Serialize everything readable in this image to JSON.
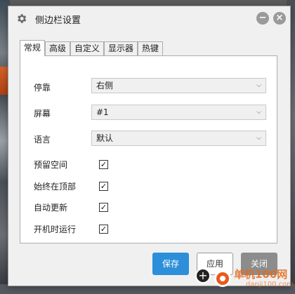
{
  "window": {
    "title": "侧边栏设置",
    "minimize_symbol": "−",
    "close_symbol": "×"
  },
  "tabs": [
    {
      "label": "常规",
      "active": true
    },
    {
      "label": "高级",
      "active": false
    },
    {
      "label": "自定义",
      "active": false
    },
    {
      "label": "显示器",
      "active": false
    },
    {
      "label": "热键",
      "active": false
    }
  ],
  "settings": {
    "dock": {
      "label": "停靠",
      "value": "右侧"
    },
    "screen": {
      "label": "屏幕",
      "value": "#1"
    },
    "language": {
      "label": "语言",
      "value": "默认"
    }
  },
  "checkboxes": [
    {
      "label": "预留空间",
      "checked": true
    },
    {
      "label": "始终在顶部",
      "checked": true
    },
    {
      "label": "自动更新",
      "checked": true
    },
    {
      "label": "开机时运行",
      "checked": true
    }
  ],
  "buttons": {
    "save": "保存",
    "apply": "应用",
    "close": "关闭"
  },
  "watermark": {
    "text": "单机100网",
    "sub": "danji100.com"
  },
  "icons": {
    "title_icon": "gear-icon",
    "select_caret": "chevron-down-icon",
    "check": "checkmark-icon"
  },
  "colors": {
    "accent": "#2d8fd9",
    "close_button": "#8c8c8c"
  }
}
